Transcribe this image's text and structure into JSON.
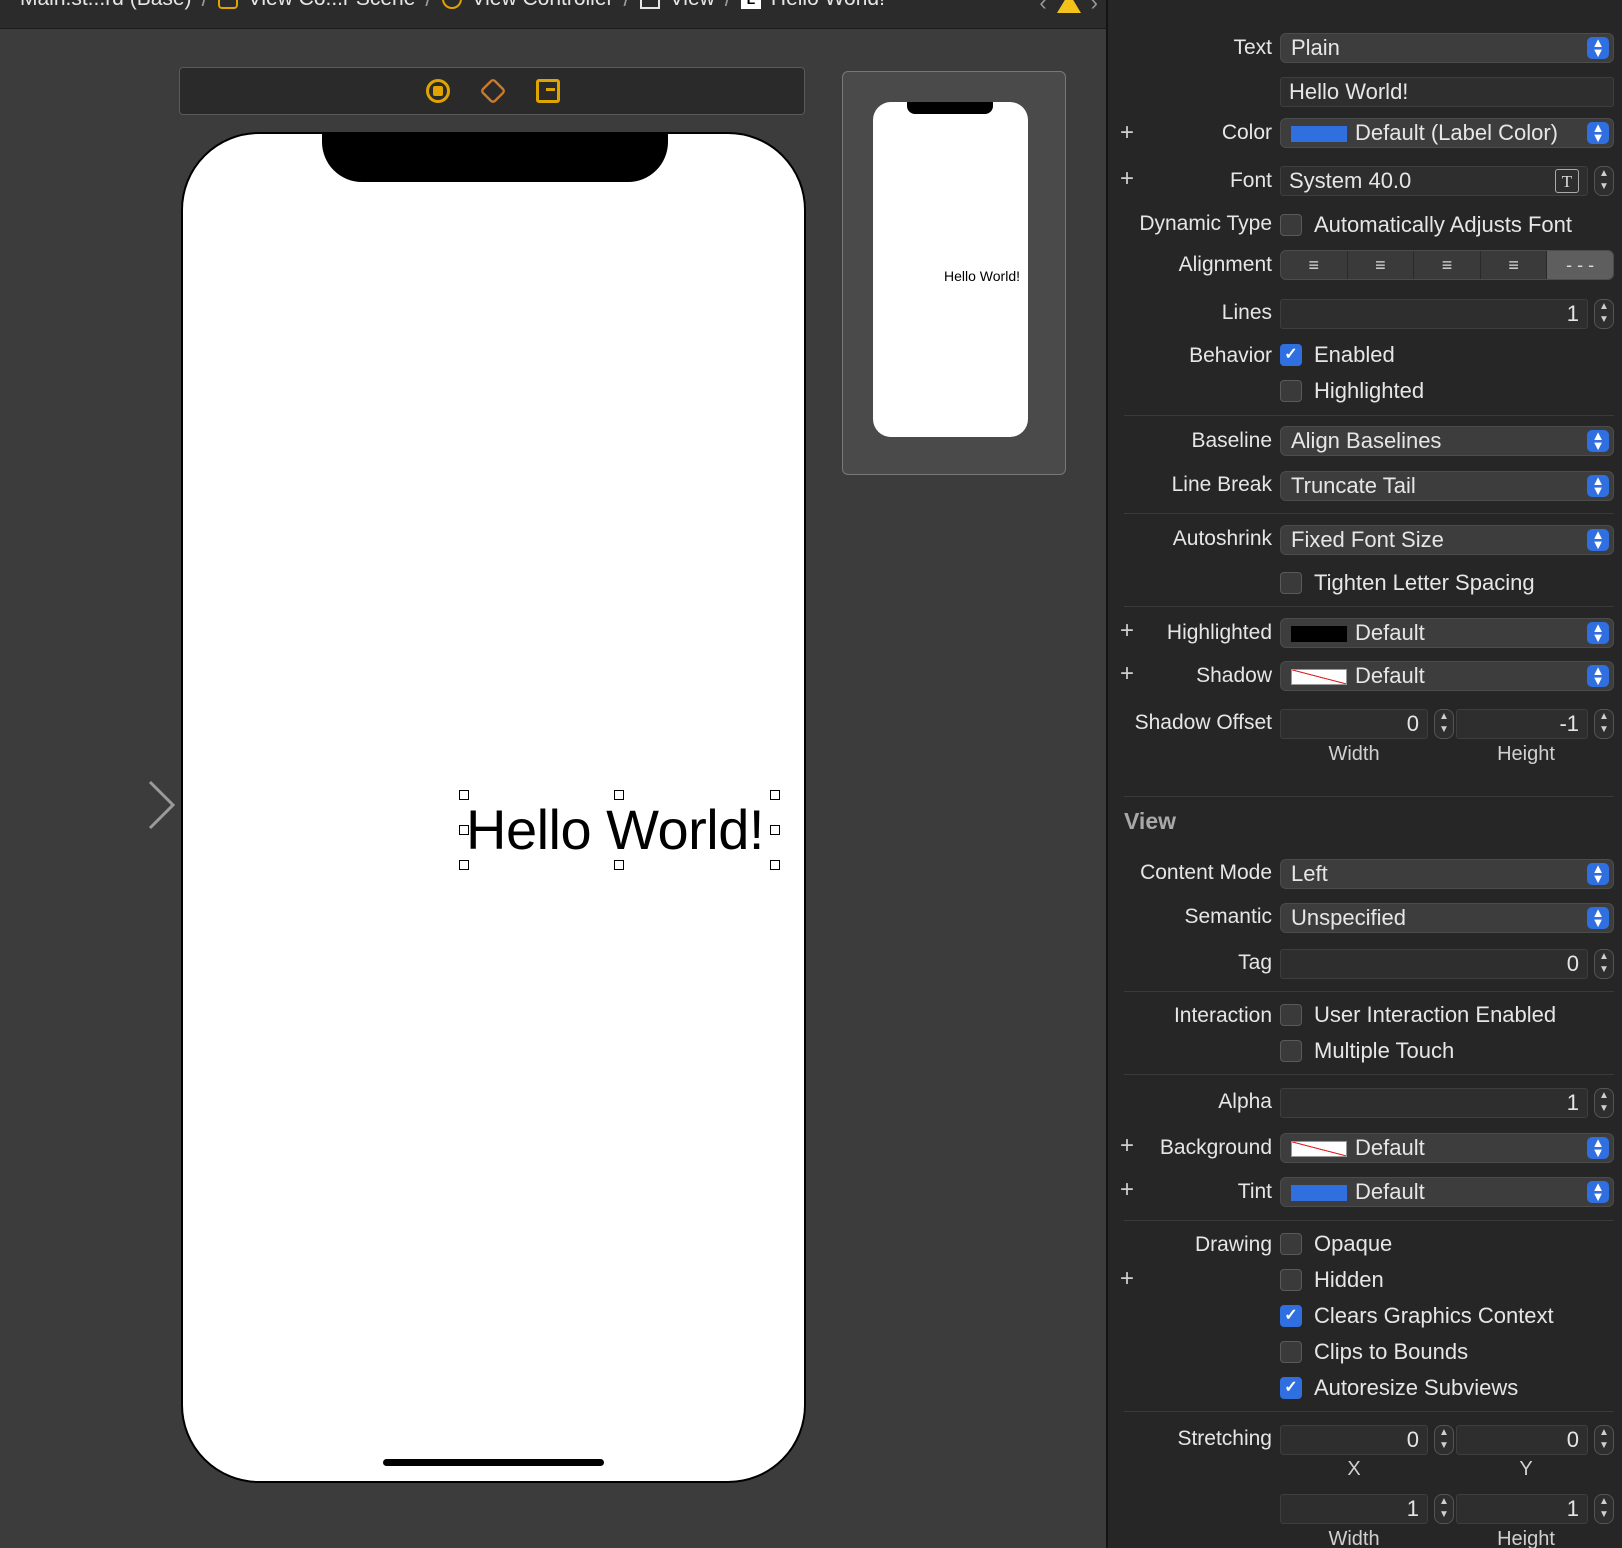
{
  "breadcrumb": {
    "items": [
      "Main.st...rd (Base)",
      "View Co...r Scene",
      "View Controller",
      "View",
      "Hello World!"
    ],
    "separator": "/"
  },
  "canvas": {
    "label_text": "Hello World!",
    "minimap_label": "Hello World!"
  },
  "inspector": {
    "label_section": {
      "text_label": "Text",
      "text_value": "Plain",
      "text_field": "Hello World!",
      "color_label": "Color",
      "color_value": "Default (Label Color)",
      "font_label": "Font",
      "font_value": "System 40.0",
      "dynamic_type_label": "Dynamic Type",
      "dynamic_type_option": "Automatically Adjusts Font",
      "alignment_label": "Alignment",
      "lines_label": "Lines",
      "lines_value": "1",
      "behavior_label": "Behavior",
      "enabled_label": "Enabled",
      "highlighted_option": "Highlighted",
      "baseline_label": "Baseline",
      "baseline_value": "Align Baselines",
      "line_break_label": "Line Break",
      "line_break_value": "Truncate Tail",
      "autoshrink_label": "Autoshrink",
      "autoshrink_value": "Fixed Font Size",
      "tighten_label": "Tighten Letter Spacing",
      "highlighted_label": "Highlighted",
      "highlighted_value": "Default",
      "shadow_label": "Shadow",
      "shadow_value": "Default",
      "shadow_offset_label": "Shadow Offset",
      "shadow_width": "0",
      "shadow_height": "-1",
      "width_caption": "Width",
      "height_caption": "Height"
    },
    "view_section": {
      "title": "View",
      "content_mode_label": "Content Mode",
      "content_mode_value": "Left",
      "semantic_label": "Semantic",
      "semantic_value": "Unspecified",
      "tag_label": "Tag",
      "tag_value": "0",
      "interaction_label": "Interaction",
      "user_interaction": "User Interaction Enabled",
      "multiple_touch": "Multiple Touch",
      "alpha_label": "Alpha",
      "alpha_value": "1",
      "background_label": "Background",
      "background_value": "Default",
      "tint_label": "Tint",
      "tint_value": "Default",
      "drawing_label": "Drawing",
      "opaque": "Opaque",
      "hidden": "Hidden",
      "clears_graphics": "Clears Graphics Context",
      "clips_to_bounds": "Clips to Bounds",
      "autoresize": "Autoresize Subviews",
      "stretching_label": "Stretching",
      "stretch_x": "0",
      "stretch_y": "0",
      "x_caption": "X",
      "y_caption": "Y",
      "stretch_width": "1",
      "stretch_height": "1",
      "width_caption": "Width",
      "height_caption": "Height"
    }
  },
  "colors": {
    "accent": "#2f6fe0",
    "canvas_bg": "#3c3c3c",
    "inspector_bg": "#262626",
    "warning": "#f3c21b"
  }
}
